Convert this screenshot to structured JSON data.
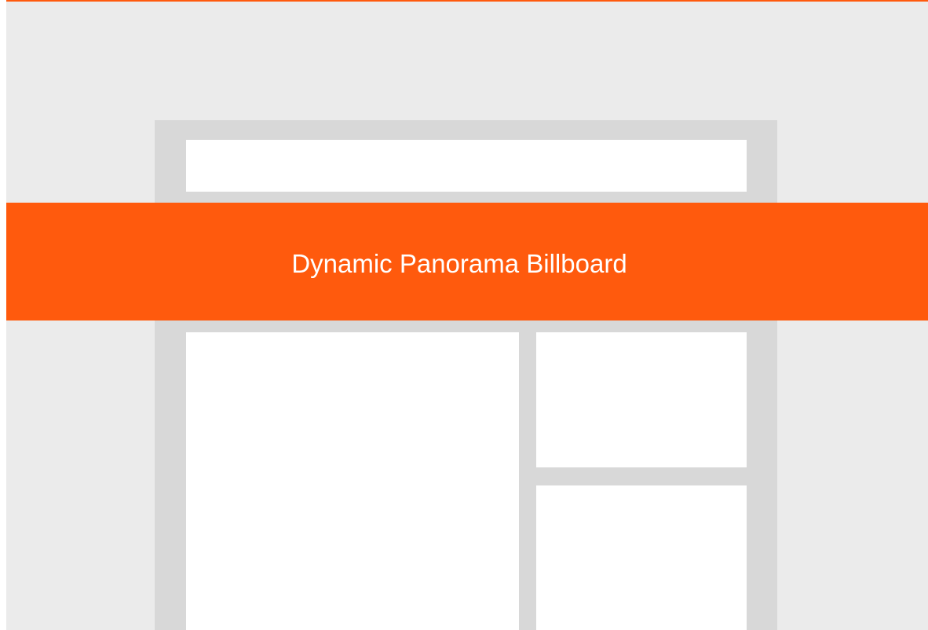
{
  "billboard": {
    "label": "Dynamic Panorama Billboard"
  },
  "colors": {
    "background": "#ebebeb",
    "frame": "#d8d8d8",
    "slot": "#ffffff",
    "accent": "#ff5a0d",
    "text": "#ffffff"
  }
}
